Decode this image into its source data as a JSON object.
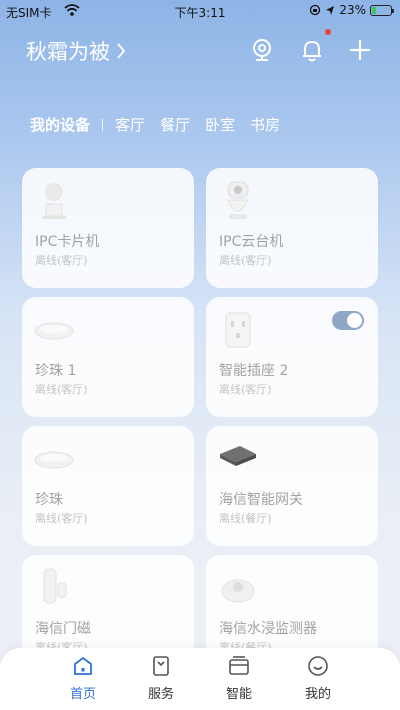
{
  "status_bar": {
    "carrier": "无SIM卡",
    "time": "下午3:11",
    "battery": "23%",
    "battery_level": 0.23
  },
  "header": {
    "home_name": "秋霜为被",
    "icons": [
      "camera-icon",
      "bell-icon",
      "plus-icon"
    ],
    "has_notification": true
  },
  "room_tabs": [
    {
      "label": "我的设备",
      "active": true
    },
    {
      "label": "客厅"
    },
    {
      "label": "餐厅"
    },
    {
      "label": "卧室"
    },
    {
      "label": "书房"
    }
  ],
  "devices": [
    {
      "name": "IPC卡片机",
      "status": "离线(客厅)",
      "icon": "ipc-card-camera-icon"
    },
    {
      "name": "IPC云台机",
      "status": "离线(客厅)",
      "icon": "ptz-camera-icon"
    },
    {
      "name": "珍珠 1",
      "status": "离线(客厅)",
      "icon": "pearl-hub-icon"
    },
    {
      "name": "智能插座 2",
      "status": "离线(客厅)",
      "icon": "smart-socket-icon",
      "toggle_on": true
    },
    {
      "name": "珍珠",
      "status": "离线(客厅)",
      "icon": "pearl-hub-icon"
    },
    {
      "name": "海信智能网关",
      "status": "离线(餐厅)",
      "icon": "gateway-icon"
    },
    {
      "name": "海信门磁",
      "status": "离线(客厅)",
      "icon": "door-sensor-icon"
    },
    {
      "name": "海信水浸监测器",
      "status": "离线(餐厅)",
      "icon": "water-leak-sensor-icon"
    }
  ],
  "tabbar": [
    {
      "label": "首页",
      "icon": "home-icon",
      "active": true
    },
    {
      "label": "服务",
      "icon": "service-icon"
    },
    {
      "label": "智能",
      "icon": "smart-icon"
    },
    {
      "label": "我的",
      "icon": "profile-icon"
    }
  ],
  "colors": {
    "accent": "#2f72d8",
    "notification_dot": "#e8433a",
    "toggle_on": "#8fa7c7"
  }
}
